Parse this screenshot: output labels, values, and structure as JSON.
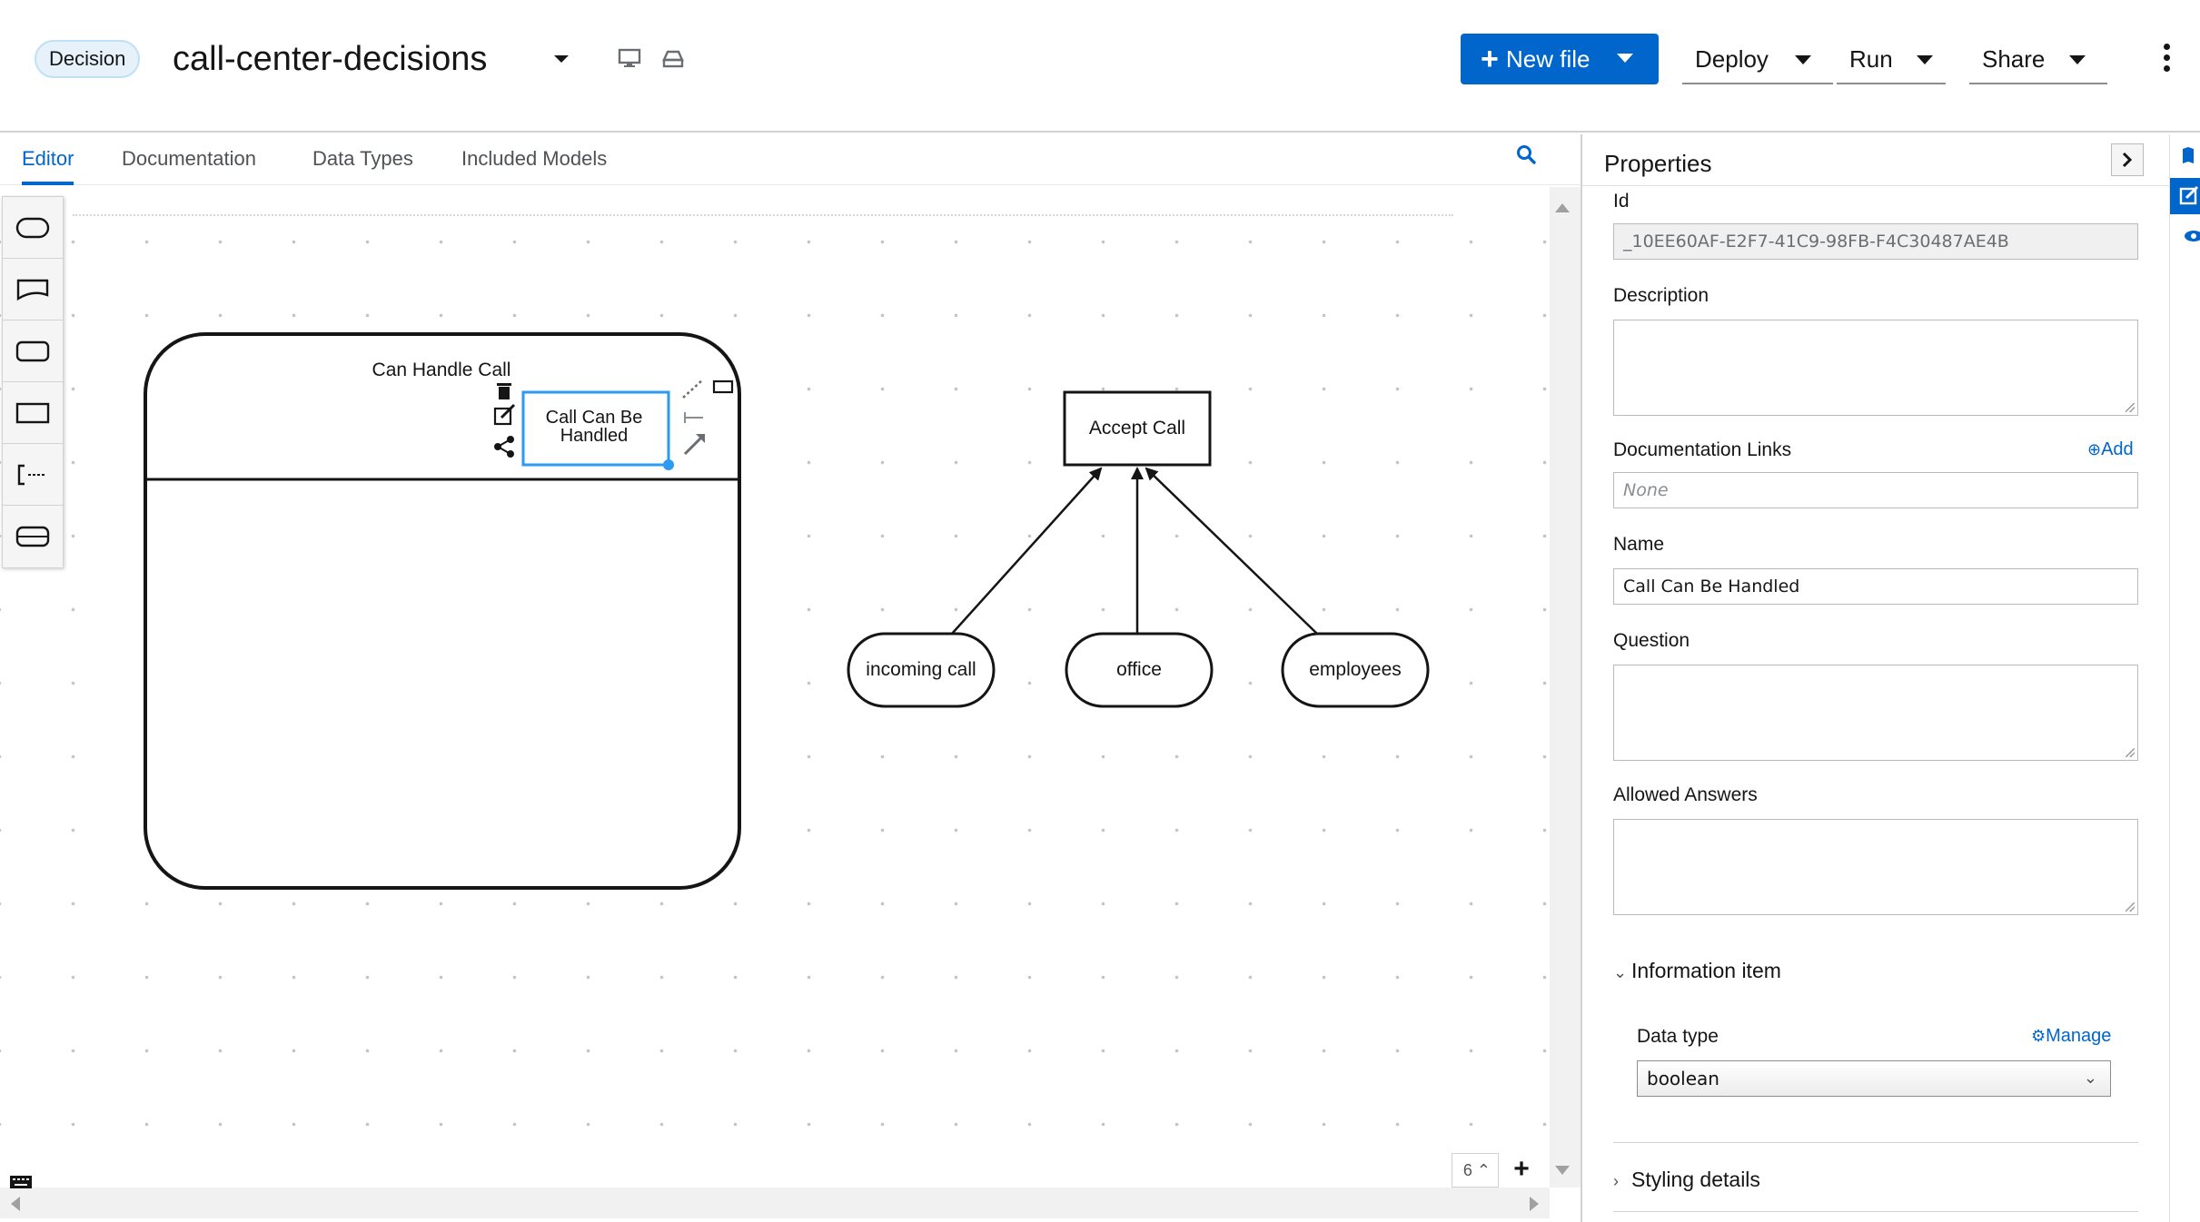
{
  "header": {
    "badge": "Decision",
    "file_name": "call-center-decisions",
    "new_file_label": "New file",
    "deploy_label": "Deploy",
    "run_label": "Run",
    "share_label": "Share"
  },
  "tabs": [
    {
      "label": "Editor",
      "active": true
    },
    {
      "label": "Documentation",
      "active": false
    },
    {
      "label": "Data Types",
      "active": false
    },
    {
      "label": "Included Models",
      "active": false
    }
  ],
  "diagram": {
    "decision_service_label": "Can Handle Call",
    "selected_node_label": "Call Can Be Handled",
    "decision_label": "Accept Call",
    "inputs": [
      "incoming call",
      "office",
      "employees"
    ]
  },
  "zoom": {
    "value": "6"
  },
  "properties": {
    "title": "Properties",
    "id_label": "Id",
    "id_value": "_10EE60AF-E2F7-41C9-98FB-F4C30487AE4B",
    "description_label": "Description",
    "doc_links_label": "Documentation Links",
    "doc_links_add": "Add",
    "doc_links_placeholder": "None",
    "name_label": "Name",
    "name_value": "Call Can Be Handled",
    "question_label": "Question",
    "allowed_answers_label": "Allowed Answers",
    "info_item_label": "Information item",
    "data_type_label": "Data type",
    "manage_label": "Manage",
    "data_type_value": "boolean",
    "styling_label": "Styling details"
  },
  "colors": {
    "primary": "#0066cc",
    "badge_bg": "#e7f1fa",
    "selection": "#2b9af3"
  }
}
